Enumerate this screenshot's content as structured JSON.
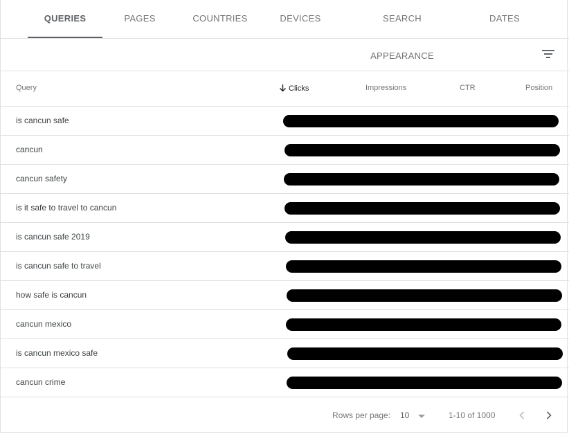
{
  "tabs": [
    {
      "label": "QUERIES",
      "active": true
    },
    {
      "label": "PAGES"
    },
    {
      "label": "COUNTRIES"
    },
    {
      "label": "DEVICES"
    },
    {
      "label": "SEARCH APPEARANCE"
    },
    {
      "label": "DATES"
    }
  ],
  "toolbar": {
    "filter_icon": "filter-icon"
  },
  "table": {
    "columns": [
      "Query",
      "Clicks",
      "Impressions",
      "CTR",
      "Position"
    ],
    "sorted_column": "Clicks",
    "sort_direction": "descending",
    "rows": [
      "is cancun safe",
      "cancun",
      "cancun safety",
      "is it safe to travel to cancun",
      "is cancun safe 2019",
      "is cancun safe to travel",
      "how safe is cancun",
      "cancun mexico",
      "is cancun mexico safe",
      "cancun crime"
    ],
    "redaction_color": "#000000"
  },
  "footer": {
    "rows_per_page_label": "Rows per page:",
    "rows_per_page_value": "10",
    "range": "1-10 of 1000"
  },
  "colors": {
    "border": "#e0e0e0",
    "muted_text": "#757575",
    "active_tab": "#5f6368"
  }
}
